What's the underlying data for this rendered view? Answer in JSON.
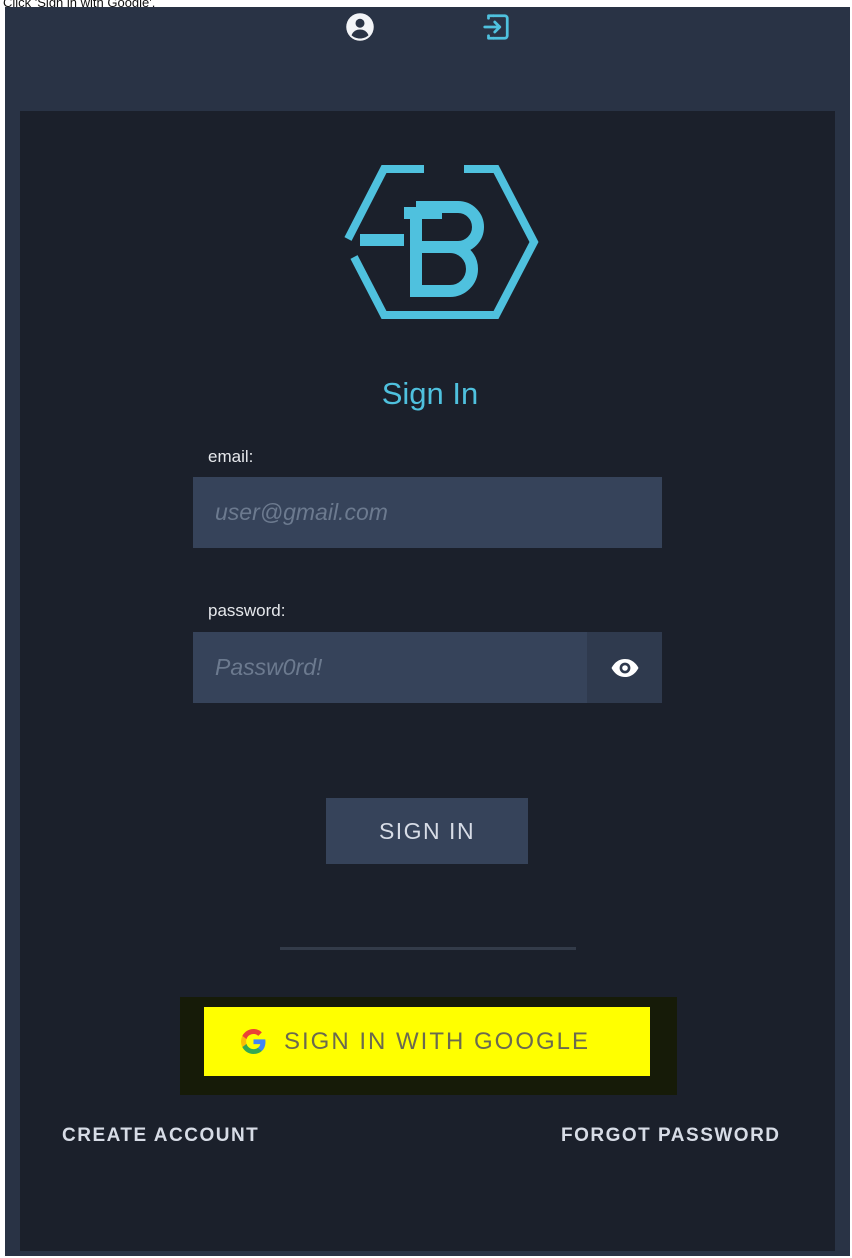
{
  "instruction": "Click 'Sign in with Google'.",
  "topbar": {
    "icons": [
      "account-circle-icon",
      "sign-in-icon"
    ],
    "active_color": "#4fc1de"
  },
  "auth": {
    "title": "Sign In",
    "logo_letter": "B",
    "email_label": "email:",
    "email_value": "",
    "email_placeholder": "user@gmail.com",
    "password_label": "password:",
    "password_value": "",
    "password_placeholder": "Passw0rd!",
    "signin_button": "SIGN IN",
    "google_button": "SIGN IN WITH GOOGLE",
    "create_account": "CREATE ACCOUNT",
    "forgot_password": "FORGOT PASSWORD"
  },
  "colors": {
    "accent": "#4fc1de",
    "highlight": "#ffff00",
    "panel": "#1b202b",
    "topbar": "#293345"
  }
}
